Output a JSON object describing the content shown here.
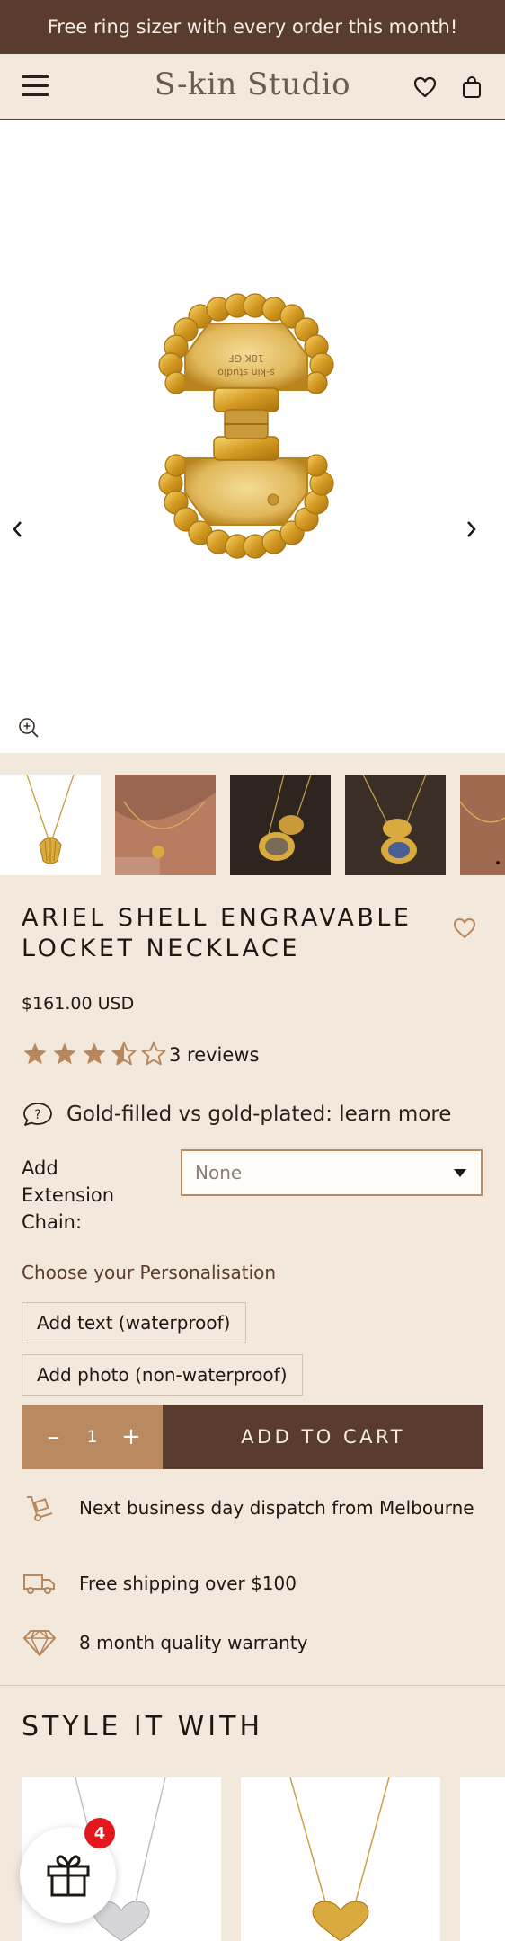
{
  "announcement": {
    "text": "Free ring sizer with every order this month!"
  },
  "header": {
    "logo": "S-kin Studio",
    "icons": {
      "menu": "hamburger-icon",
      "wishlist": "heart-icon",
      "cart": "shopping-bag-icon"
    }
  },
  "gallery": {
    "main_image": "gold-shell-locket-open-photo",
    "engraving_lines": [
      "s-kin studio",
      "18K GF"
    ],
    "thumbnails": [
      "shell-necklace-on-white",
      "necklace-worn-on-neck",
      "locket-open-with-photo-dark-bg",
      "locket-with-blue-photo",
      "necklace-worn-closeup"
    ]
  },
  "product": {
    "title": "ARIEL SHELL ENGRAVABLE LOCKET NECKLACE",
    "price": "$161.00 USD",
    "rating": 3.5,
    "rating_max": 5,
    "reviews": "3 reviews",
    "learn_more": "Gold-filled vs gold-plated: learn more"
  },
  "options": {
    "extension_label": "Add Extension Chain:",
    "extension_value": "None",
    "personalisation_label": "Choose your Personalisation",
    "personalisation_buttons": [
      "Add text (waterproof)",
      "Add photo (non-waterproof)"
    ]
  },
  "purchase": {
    "quantity": "1",
    "add_to_cart": "ADD TO CART"
  },
  "features": [
    {
      "icon": "hand-truck-icon",
      "text": "Next business day dispatch from Melbourne"
    },
    {
      "icon": "delivery-truck-icon",
      "text": "Free shipping over $100"
    },
    {
      "icon": "diamond-icon",
      "text": "8 month quality warranty"
    }
  ],
  "style_it_with": {
    "heading": "STYLE IT WITH"
  },
  "rewards": {
    "badge_count": "4",
    "icon": "gift-icon"
  },
  "colors": {
    "brown": "#5a3c2e",
    "tan": "#b98a5f",
    "background": "#f3e8dc",
    "star": "#b8875c",
    "badge": "#e4161e"
  }
}
